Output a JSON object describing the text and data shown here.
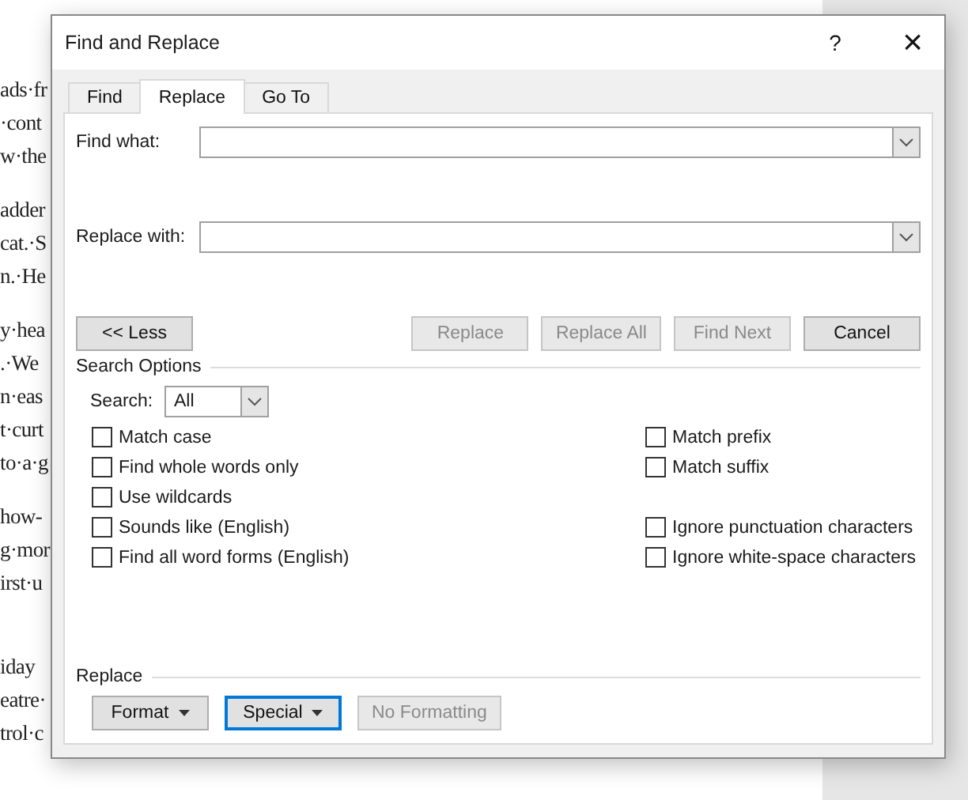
{
  "document": {
    "paragraphs": [
      {
        "lines": [
          "ads·fr",
          "·cont",
          "w·the"
        ]
      },
      {
        "lines": [
          "adder",
          "cat.·S",
          "n.·He"
        ]
      },
      {
        "lines": [
          "y·hea",
          ".·We",
          "n·eas",
          "t·curt",
          "to·a·g"
        ]
      },
      {
        "lines": [
          "how-",
          "g·mor",
          "irst·u"
        ]
      },
      {
        "lines": [
          "iday",
          "eatre·",
          "trol·c"
        ]
      }
    ]
  },
  "dialog": {
    "title": "Find and Replace",
    "help": "?",
    "close": "×",
    "tabs": [
      {
        "label": "Find",
        "selected": false
      },
      {
        "label": "Replace",
        "selected": true
      },
      {
        "label": "Go To",
        "selected": false
      }
    ],
    "find_what": {
      "label": "Find what:"
    },
    "replace_with": {
      "label": "Replace with:"
    },
    "less_button": {
      "label": "<< Less",
      "disabled": false
    },
    "action_buttons": [
      {
        "label": "Replace",
        "disabled": true
      },
      {
        "label": "Replace All",
        "disabled": true
      },
      {
        "label": "Find Next",
        "disabled": true
      },
      {
        "label": "Cancel",
        "disabled": false
      }
    ],
    "search_options": {
      "heading": "Search Options",
      "search_label": "Search:",
      "search_value": "All",
      "left_options": [
        {
          "label": "Match case",
          "checked": false
        },
        {
          "label": "Find whole words only",
          "checked": false
        },
        {
          "label": "Use wildcards",
          "checked": false
        },
        {
          "label": "Sounds like (English)",
          "checked": false
        },
        {
          "label": "Find all word forms (English)",
          "checked": false
        }
      ],
      "right_groups": [
        {
          "options": [
            {
              "label": "Match prefix",
              "checked": false
            },
            {
              "label": "Match suffix",
              "checked": false
            }
          ]
        },
        {
          "options": [
            {
              "label": "Ignore punctuation characters",
              "checked": false
            },
            {
              "label": "Ignore white-space characters",
              "checked": false
            }
          ]
        }
      ]
    },
    "replace_section": {
      "heading": "Replace",
      "buttons": [
        {
          "label": "Format",
          "menu": true,
          "focused": false,
          "disabled": false
        },
        {
          "label": "Special",
          "menu": true,
          "focused": true,
          "disabled": false
        },
        {
          "label": "No Formatting",
          "menu": false,
          "focused": false,
          "disabled": true
        }
      ]
    }
  }
}
